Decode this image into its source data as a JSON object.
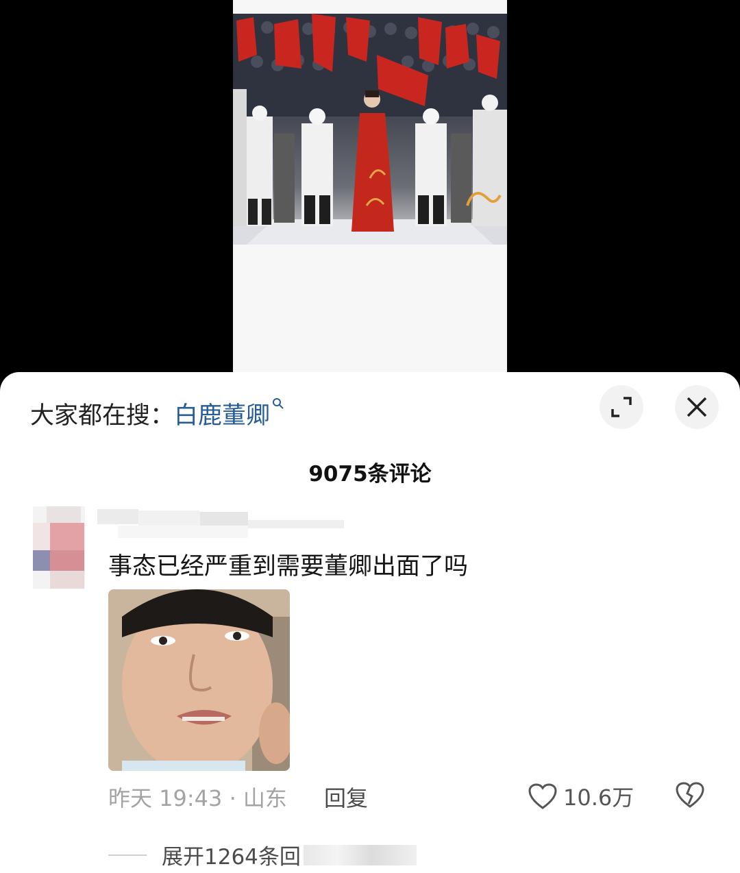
{
  "search_bar": {
    "prefix": "大家都在搜：",
    "keyword": "白鹿董卿",
    "icon": "search-icon"
  },
  "controls": {
    "expand_icon": "expand-icon",
    "close_icon": "close-icon"
  },
  "comments_header": {
    "count_label": "9075条评论"
  },
  "comment": {
    "text": "事态已经严重到需要董卿出面了吗",
    "time": "昨天 19:43 · 山东",
    "reply_label": "回复",
    "like_count": "10.6万",
    "expand_label": "展开1264条回"
  },
  "colors": {
    "keyword": "#275c94",
    "meta": "#a3a3a3",
    "video_bg": "#000000"
  }
}
